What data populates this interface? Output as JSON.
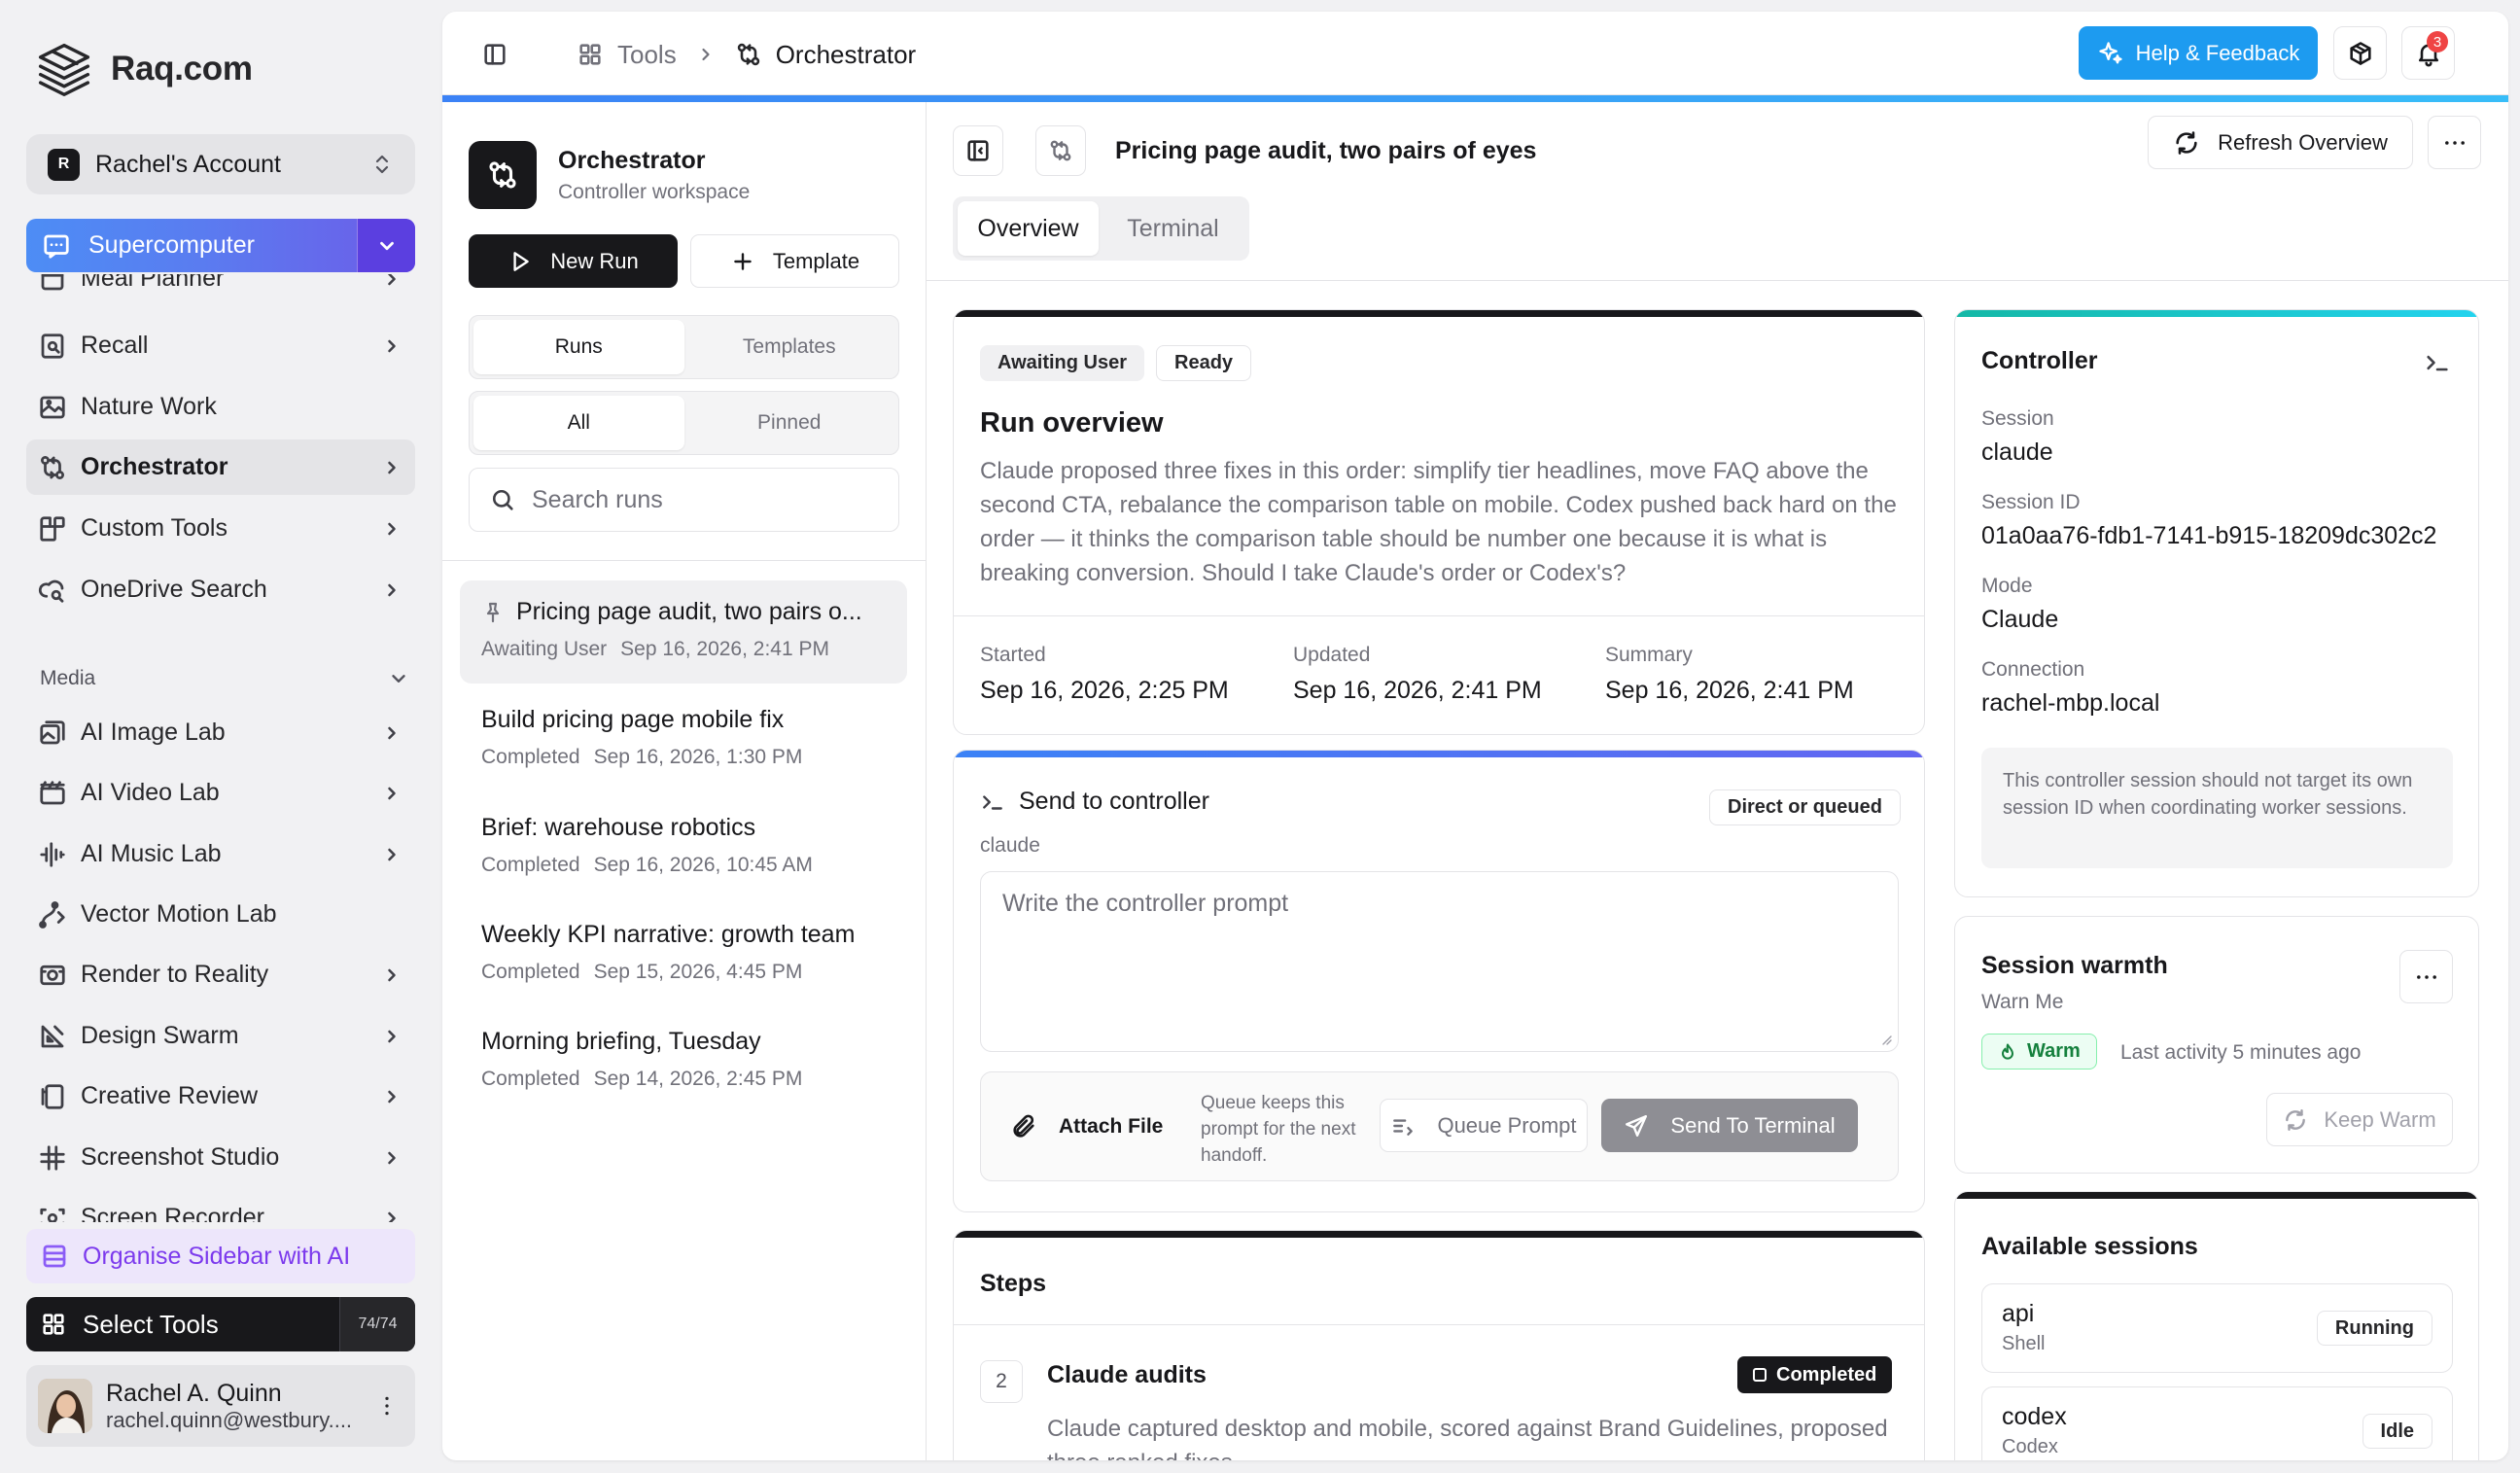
{
  "brand": {
    "name": "Raq.com"
  },
  "account": {
    "initial": "R",
    "label": "Rachel's Account"
  },
  "supercomputer": {
    "label": "Supercomputer"
  },
  "nav": {
    "items": [
      {
        "label": "Meal Planner",
        "icon": "meal-icon",
        "chevron": true
      },
      {
        "label": "Recall",
        "icon": "recall-icon",
        "chevron": true
      },
      {
        "label": "Nature Work",
        "icon": "nature-icon",
        "chevron": false
      },
      {
        "label": "Orchestrator",
        "icon": "orchestrator-icon",
        "chevron": true,
        "active": true
      },
      {
        "label": "Custom Tools",
        "icon": "custom-tools-icon",
        "chevron": true
      },
      {
        "label": "OneDrive Search",
        "icon": "onedrive-search-icon",
        "chevron": true
      }
    ],
    "media_label": "Media",
    "media_items": [
      {
        "label": "AI Image Lab",
        "icon": "image-lab-icon",
        "chevron": true
      },
      {
        "label": "AI Video Lab",
        "icon": "video-lab-icon",
        "chevron": true
      },
      {
        "label": "AI Music Lab",
        "icon": "music-lab-icon",
        "chevron": true
      },
      {
        "label": "Vector Motion Lab",
        "icon": "vector-motion-icon",
        "chevron": false
      },
      {
        "label": "Render to Reality",
        "icon": "render-icon",
        "chevron": true
      },
      {
        "label": "Design Swarm",
        "icon": "design-swarm-icon",
        "chevron": true
      },
      {
        "label": "Creative Review",
        "icon": "creative-review-icon",
        "chevron": true
      },
      {
        "label": "Screenshot Studio",
        "icon": "screenshot-icon",
        "chevron": true
      },
      {
        "label": "Screen Recorder",
        "icon": "screen-recorder-icon",
        "chevron": true
      }
    ]
  },
  "organise": {
    "label": "Organise Sidebar with AI"
  },
  "select_tools": {
    "label": "Select Tools",
    "count": "74/74"
  },
  "user": {
    "name": "Rachel A. Quinn",
    "email": "rachel.quinn@westbury...."
  },
  "topbar": {
    "crumb_tools": "Tools",
    "crumb_current": "Orchestrator",
    "help_label": "Help & Feedback",
    "notifications": "3"
  },
  "runs_panel": {
    "title": "Orchestrator",
    "subtitle": "Controller workspace",
    "new_run": "New Run",
    "template": "Template",
    "tab_runs": "Runs",
    "tab_templates": "Templates",
    "filter_all": "All",
    "filter_pinned": "Pinned",
    "search_placeholder": "Search runs",
    "runs": [
      {
        "title": "Pricing page audit, two pairs o...",
        "status": "Awaiting User",
        "date": "Sep 16, 2026, 2:41 PM",
        "pinned": true,
        "selected": true
      },
      {
        "title": "Build pricing page mobile fix",
        "status": "Completed",
        "date": "Sep 16, 2026, 1:30 PM"
      },
      {
        "title": "Brief: warehouse robotics",
        "status": "Completed",
        "date": "Sep 16, 2026, 10:45 AM"
      },
      {
        "title": "Weekly KPI narrative: growth team",
        "status": "Completed",
        "date": "Sep 15, 2026, 4:45 PM"
      },
      {
        "title": "Morning briefing, Tuesday",
        "status": "Completed",
        "date": "Sep 14, 2026, 2:45 PM"
      }
    ]
  },
  "content": {
    "run_title": "Pricing page audit, two pairs of eyes",
    "refresh_label": "Refresh Overview",
    "tab_overview": "Overview",
    "tab_terminal": "Terminal",
    "overview": {
      "badge_status": "Awaiting User",
      "badge_ready": "Ready",
      "title": "Run overview",
      "body": "Claude proposed three fixes in this order: simplify tier headlines, move FAQ above the second CTA, rebalance the comparison table on mobile. Codex pushed back hard on the order — it thinks the comparison table should be number one because it is what is breaking conversion. Should I take Claude's order or Codex's?",
      "started_label": "Started",
      "started_value": "Sep 16, 2026, 2:25 PM",
      "updated_label": "Updated",
      "updated_value": "Sep 16, 2026, 2:41 PM",
      "summary_label": "Summary",
      "summary_value": "Sep 16, 2026, 2:41 PM"
    },
    "send": {
      "title": "Send to controller",
      "subtitle": "claude",
      "mode_pill": "Direct or queued",
      "placeholder": "Write the controller prompt",
      "attach": "Attach File",
      "queue_note": "Queue keeps this prompt for the next handoff.",
      "queue_btn": "Queue Prompt",
      "send_btn": "Send To Terminal"
    },
    "steps": {
      "title": "Steps",
      "step_number": "2",
      "step_title": "Claude audits",
      "step_status": "Completed",
      "step_body": "Claude captured desktop and mobile, scored against Brand Guidelines, proposed three ranked fixes."
    }
  },
  "controller": {
    "title": "Controller",
    "session_label": "Session",
    "session_value": "claude",
    "session_id_label": "Session ID",
    "session_id_value": "01a0aa76-fdb1-7141-b915-18209dc302c2",
    "mode_label": "Mode",
    "mode_value": "Claude",
    "connection_label": "Connection",
    "connection_value": "rachel-mbp.local",
    "note": "This controller session should not target its own session ID when coordinating worker sessions."
  },
  "warmth": {
    "title": "Session warmth",
    "subtitle": "Warn Me",
    "status": "Warm",
    "last_activity": "Last activity 5 minutes ago",
    "keep_warm": "Keep Warm"
  },
  "sessions": {
    "title": "Available sessions",
    "items": [
      {
        "name": "api",
        "type": "Shell",
        "status": "Running"
      },
      {
        "name": "codex",
        "type": "Codex",
        "status": "Idle"
      }
    ]
  },
  "colors": {
    "accent_blue": "#1d9bf0",
    "supercomputer_gradient_start": "#4d8df5",
    "supercomputer_gradient_end": "#6d5ce8",
    "organise_bg": "#ede6fb",
    "warm_green": "#15803d",
    "notification_red": "#ef4444",
    "send_card_topline": "#6366f1",
    "controller_topline": "#14b8a6"
  }
}
